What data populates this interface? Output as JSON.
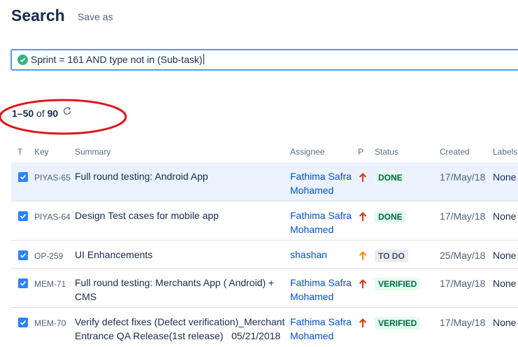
{
  "header": {
    "title": "Search",
    "save_as": "Save as"
  },
  "query": {
    "text": "Sprint = 161 AND type not in (Sub-task)"
  },
  "results": {
    "range": "1–50",
    "of_word": "of",
    "total": "90"
  },
  "columns": {
    "type": "T",
    "key": "Key",
    "summary": "Summary",
    "assignee": "Assignee",
    "priority": "P",
    "status": "Status",
    "created": "Created",
    "labels": "Labels"
  },
  "colors": {
    "accent": "#4c9aff",
    "checkbox": "#2684ff",
    "priority_high": "#de350b",
    "priority_medium": "#ff8b00",
    "annotation": "#e0161e"
  },
  "issues": [
    {
      "key": "PIYAS-65",
      "summary": "Full round testing: Android App",
      "assignee_line1": "Fathima Safra",
      "assignee_line2": "Mohamed",
      "priority": "high",
      "status": "DONE",
      "created": "17/May/18",
      "labels": "None"
    },
    {
      "key": "PIYAS-64",
      "summary": "Design Test cases for mobile app",
      "assignee_line1": "Fathima Safra",
      "assignee_line2": "Mohamed",
      "priority": "high",
      "status": "DONE",
      "created": "17/May/18",
      "labels": "None"
    },
    {
      "key": "OP-259",
      "summary": "UI Enhancements",
      "assignee_line1": "shashan",
      "assignee_line2": "",
      "priority": "medium",
      "status": "TO DO",
      "created": "25/May/18",
      "labels": "None"
    },
    {
      "key": "MEM-71",
      "summary_line1": "Full round testing: Merchants App ( Android) +",
      "summary_line2": "CMS",
      "assignee_line1": "Fathima Safra",
      "assignee_line2": "Mohamed",
      "priority": "high",
      "status": "VERIFIED",
      "created": "17/May/18",
      "labels": "None"
    },
    {
      "key": "MEM-70",
      "summary_line1": "Verify defect fixes (Defect verification)_Merchant",
      "summary_line2": "Entrance QA Release(1st release)   05/21/2018",
      "assignee_line1": "Fathima Safra",
      "assignee_line2": "Mohamed",
      "priority": "high",
      "status": "VERIFIED",
      "created": "17/May/18",
      "labels": "None"
    }
  ]
}
